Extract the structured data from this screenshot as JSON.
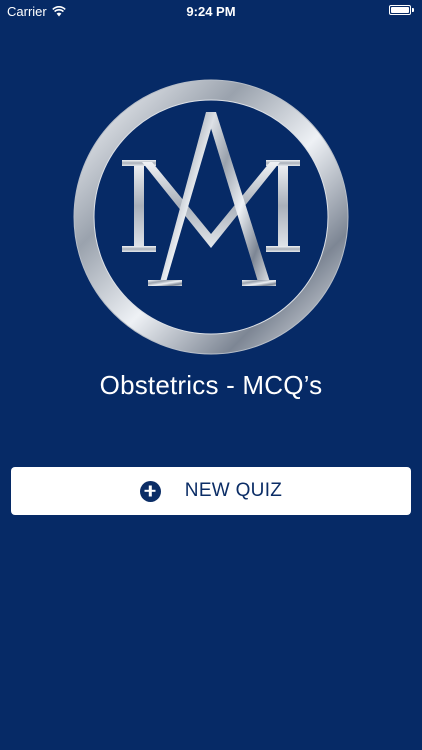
{
  "status_bar": {
    "carrier": "Carrier",
    "time": "9:24 PM",
    "wifi_icon": "wifi-icon",
    "battery_icon": "battery-icon",
    "battery_level": 1.0
  },
  "logo": {
    "icon": "ma-monogram-ring-logo"
  },
  "app_title": "Obstetrics - MCQ’s",
  "new_quiz_button": {
    "label": "NEW QUIZ",
    "icon": "plus-circle-icon"
  },
  "colors": {
    "background": "#062a66",
    "button_background": "#ffffff",
    "button_text": "#0b2d66",
    "logo_silver": "#c9ced6"
  }
}
